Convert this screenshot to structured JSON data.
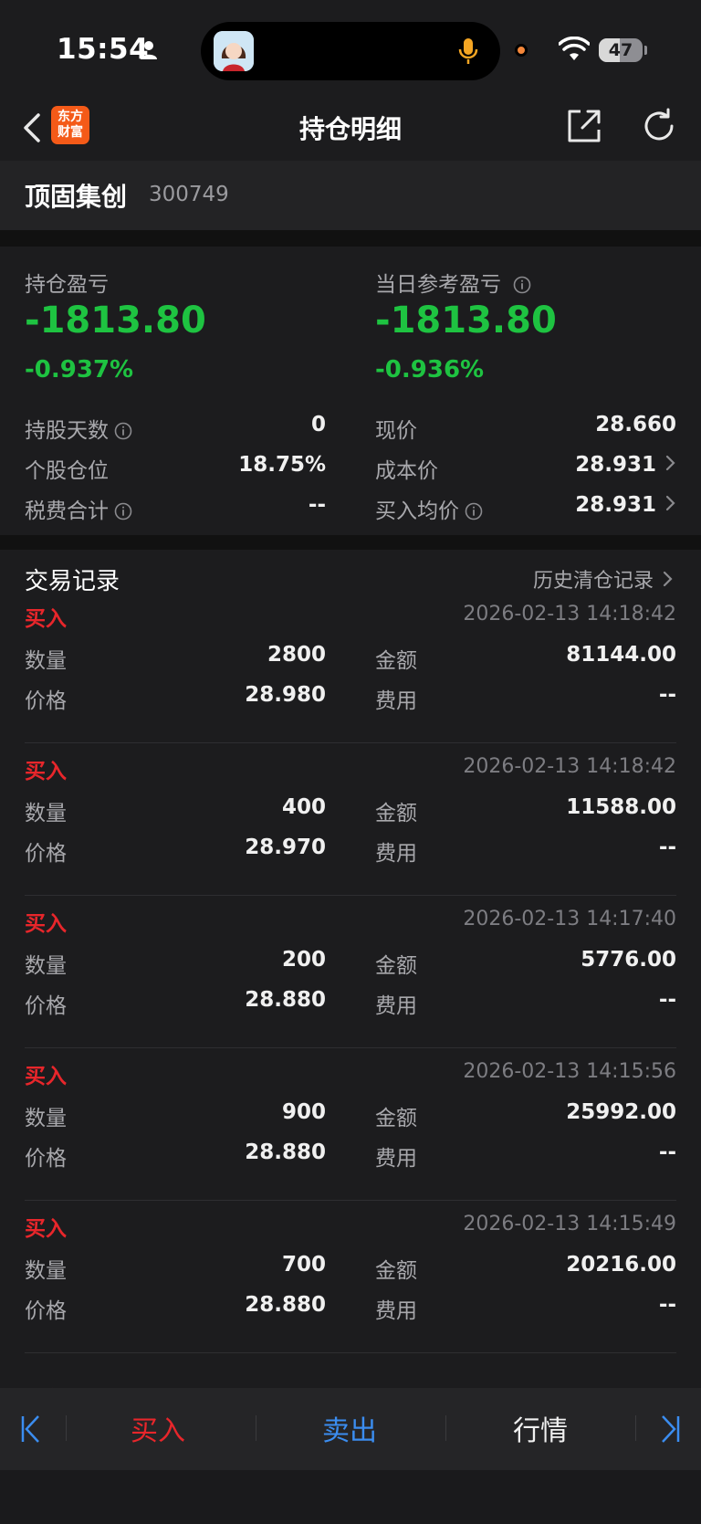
{
  "status_bar": {
    "time": "15:54",
    "battery_level": "47",
    "battery_fraction": 0.47
  },
  "nav": {
    "logo_line1": "东方",
    "logo_line2": "财富",
    "title": "持仓明细"
  },
  "stock": {
    "name": "顶固集创",
    "code": "300749"
  },
  "summary": {
    "position_pl_label": "持仓盈亏",
    "position_pl_value": "-1813.80",
    "position_pl_pct": "-0.937%",
    "daily_pl_label": "当日参考盈亏",
    "daily_pl_value": "-1813.80",
    "daily_pl_pct": "-0.936%",
    "left_rows": [
      {
        "label": "持股天数",
        "value": "0",
        "info": true
      },
      {
        "label": "个股仓位",
        "value": "18.75%",
        "info": false
      },
      {
        "label": "税费合计",
        "value": "--",
        "info": true
      }
    ],
    "right_rows": [
      {
        "label": "现价",
        "value": "28.660"
      },
      {
        "label": "成本价",
        "value": "28.931"
      },
      {
        "label": "买入均价",
        "value": "28.931"
      }
    ]
  },
  "trades": {
    "title": "交易记录",
    "history_link": "历史清仓记录",
    "labels": {
      "qty": "数量",
      "price": "价格",
      "amount": "金额",
      "fee": "费用"
    },
    "records": [
      {
        "side": "买入",
        "time": "2026-02-13 14:18:42",
        "qty": "2800",
        "price": "28.980",
        "amount": "81144.00",
        "fee": "--"
      },
      {
        "side": "买入",
        "time": "2026-02-13 14:18:42",
        "qty": "400",
        "price": "28.970",
        "amount": "11588.00",
        "fee": "--"
      },
      {
        "side": "买入",
        "time": "2026-02-13 14:17:40",
        "qty": "200",
        "price": "28.880",
        "amount": "5776.00",
        "fee": "--"
      },
      {
        "side": "买入",
        "time": "2026-02-13 14:15:56",
        "qty": "900",
        "price": "28.880",
        "amount": "25992.00",
        "fee": "--"
      },
      {
        "side": "买入",
        "time": "2026-02-13 14:15:49",
        "qty": "700",
        "price": "28.880",
        "amount": "20216.00",
        "fee": "--"
      }
    ]
  },
  "bottom_bar": {
    "buy": "买入",
    "sell": "卖出",
    "quote": "行情"
  },
  "colors": {
    "loss_green": "#1ec341",
    "buy_red": "#e8262b",
    "sell_blue": "#3b8df0",
    "brand_orange": "#f45a18"
  }
}
